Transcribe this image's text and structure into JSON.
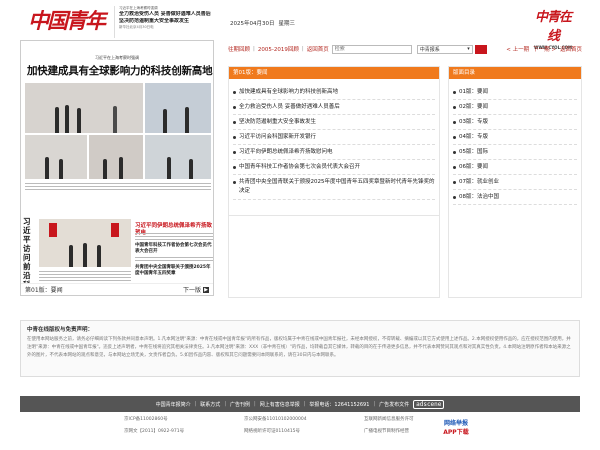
{
  "header": {
    "logo_text": "中国青年报",
    "headline_box": {
      "top": "习近平在上海考察时强调",
      "main_1": "全力救治受伤人员 妥善做好遇难人员善后",
      "main_2": "坚决防范遏制重大安全事故发生",
      "sub": "新华社北京4月30日电"
    },
    "date": "2025年04月30日",
    "weekday": "星期三",
    "brand_text": "中青在线",
    "brand_url": "WWW.CYOL.COM"
  },
  "toolbar": {
    "prev_day": "往期回顾",
    "archive": "2005-2019回顾",
    "back_home": "返回首页",
    "search_placeholder": "检索",
    "search_select_value": "中青报系",
    "prev_page": "< 上一期",
    "next_page": "下一期 >",
    "back_home_right": "返回首页"
  },
  "paper": {
    "top_caption": "习近平在上海考察时强调",
    "headline": "加快建成具有全球影响力的科技创新高地",
    "vertical_title": "习近平访问前沿科技型新兴产业银行",
    "red_headline": "习近平同伊朗总统佩泽希齐扬致贺电",
    "small_headline_1": "中国青年科技工作者协会第七次会员代表大会召开",
    "small_headline_2": "共青团中央全国青联关于颁授2025年度中国青年五四奖章",
    "page_label": "第01版：要闻",
    "next_label": "下一版"
  },
  "articles_panel": {
    "title": "第01版：要闻",
    "items": [
      "加快建成具有全球影响力的科技创新高地",
      "全力救治受伤人员 妥善做好遇难人员善后",
      "坚决防范遏制重大安全事故发生",
      "习近平访问会科国家新开发银行",
      "习近平向伊朗总统佩泽希齐扬致慰问电",
      "中国青年科技工作者协会第七次会员代表大会召开",
      "共青团中央全国青联关于颁授2025年度中国青年五四奖章暨新时代青年先锋奖的决定"
    ]
  },
  "editions_panel": {
    "title": "版面目录",
    "items": [
      "01版：要闻",
      "02版：要闻",
      "03版：专版",
      "04版：专版",
      "05版：国际",
      "06版：要闻",
      "07版：就业创业",
      "08版：法治中国"
    ]
  },
  "disclaimer": {
    "title": "中青在线版权与免责声明：",
    "body": "在使用本网站服务之前，请务必仔细阅读下列条款并同意本声明。1.凡本网注明\"来源：中青在线或中国青年报\"的所有作品，版权均属于中青在线或中国青年报社，未经本网授权，不得转载、摘编或以其它方式使用上述作品。2.本网授权使用作品的，应在授权范围内使用，并注明\"来源：中青在线或中国青年报\"。违反上述声明者，中青在线将追究其相关法律责任。3.凡本网注明\"来源：XXX（非中青在线）\"的作品，均转载自其它媒体，转载的目的在于传递更多信息，并不代表本网赞同其观点和对其真实性负责。4.本网站注明原作者和本站来源之外的图片，不代表本网站的观点和意见，与本网站立场无关，文责作者自负。5.如因作品内容、版权和其它问题需要同本网联系的，请在30日内与本网联系。"
  },
  "footer": {
    "links": [
      "中国青年报简介",
      "联系方式",
      "广告刊例",
      "网上有害信息举报",
      "举报电话：12641152691",
      "广告发布文件"
    ],
    "adscene": "adscene",
    "licenses": [
      "京ICP备11002860号",
      "京公网安备11010102000004",
      "互联网新闻信息服务许可",
      "京网文【2011】0922-971号",
      "网络视听许可证0110415号",
      "广播电视节目制作经营"
    ],
    "report_1": "网络举报",
    "report_2": "APP下载"
  },
  "colors": {
    "brand_red": "#c8161d",
    "panel_orange": "#f07a1d",
    "footer_gray": "#555555"
  }
}
